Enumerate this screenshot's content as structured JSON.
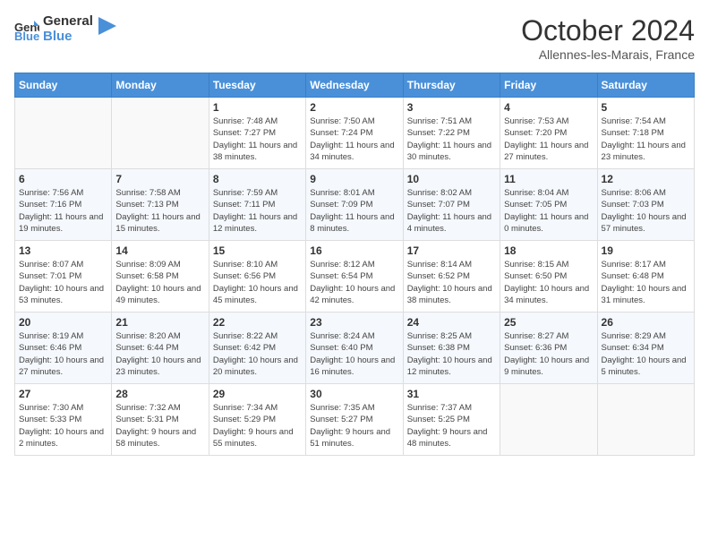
{
  "header": {
    "logo_line1": "General",
    "logo_line2": "Blue",
    "month": "October 2024",
    "location": "Allennes-les-Marais, France"
  },
  "days_of_week": [
    "Sunday",
    "Monday",
    "Tuesday",
    "Wednesday",
    "Thursday",
    "Friday",
    "Saturday"
  ],
  "weeks": [
    [
      {
        "day": "",
        "content": ""
      },
      {
        "day": "",
        "content": ""
      },
      {
        "day": "1",
        "content": "Sunrise: 7:48 AM\nSunset: 7:27 PM\nDaylight: 11 hours and 38 minutes."
      },
      {
        "day": "2",
        "content": "Sunrise: 7:50 AM\nSunset: 7:24 PM\nDaylight: 11 hours and 34 minutes."
      },
      {
        "day": "3",
        "content": "Sunrise: 7:51 AM\nSunset: 7:22 PM\nDaylight: 11 hours and 30 minutes."
      },
      {
        "day": "4",
        "content": "Sunrise: 7:53 AM\nSunset: 7:20 PM\nDaylight: 11 hours and 27 minutes."
      },
      {
        "day": "5",
        "content": "Sunrise: 7:54 AM\nSunset: 7:18 PM\nDaylight: 11 hours and 23 minutes."
      }
    ],
    [
      {
        "day": "6",
        "content": "Sunrise: 7:56 AM\nSunset: 7:16 PM\nDaylight: 11 hours and 19 minutes."
      },
      {
        "day": "7",
        "content": "Sunrise: 7:58 AM\nSunset: 7:13 PM\nDaylight: 11 hours and 15 minutes."
      },
      {
        "day": "8",
        "content": "Sunrise: 7:59 AM\nSunset: 7:11 PM\nDaylight: 11 hours and 12 minutes."
      },
      {
        "day": "9",
        "content": "Sunrise: 8:01 AM\nSunset: 7:09 PM\nDaylight: 11 hours and 8 minutes."
      },
      {
        "day": "10",
        "content": "Sunrise: 8:02 AM\nSunset: 7:07 PM\nDaylight: 11 hours and 4 minutes."
      },
      {
        "day": "11",
        "content": "Sunrise: 8:04 AM\nSunset: 7:05 PM\nDaylight: 11 hours and 0 minutes."
      },
      {
        "day": "12",
        "content": "Sunrise: 8:06 AM\nSunset: 7:03 PM\nDaylight: 10 hours and 57 minutes."
      }
    ],
    [
      {
        "day": "13",
        "content": "Sunrise: 8:07 AM\nSunset: 7:01 PM\nDaylight: 10 hours and 53 minutes."
      },
      {
        "day": "14",
        "content": "Sunrise: 8:09 AM\nSunset: 6:58 PM\nDaylight: 10 hours and 49 minutes."
      },
      {
        "day": "15",
        "content": "Sunrise: 8:10 AM\nSunset: 6:56 PM\nDaylight: 10 hours and 45 minutes."
      },
      {
        "day": "16",
        "content": "Sunrise: 8:12 AM\nSunset: 6:54 PM\nDaylight: 10 hours and 42 minutes."
      },
      {
        "day": "17",
        "content": "Sunrise: 8:14 AM\nSunset: 6:52 PM\nDaylight: 10 hours and 38 minutes."
      },
      {
        "day": "18",
        "content": "Sunrise: 8:15 AM\nSunset: 6:50 PM\nDaylight: 10 hours and 34 minutes."
      },
      {
        "day": "19",
        "content": "Sunrise: 8:17 AM\nSunset: 6:48 PM\nDaylight: 10 hours and 31 minutes."
      }
    ],
    [
      {
        "day": "20",
        "content": "Sunrise: 8:19 AM\nSunset: 6:46 PM\nDaylight: 10 hours and 27 minutes."
      },
      {
        "day": "21",
        "content": "Sunrise: 8:20 AM\nSunset: 6:44 PM\nDaylight: 10 hours and 23 minutes."
      },
      {
        "day": "22",
        "content": "Sunrise: 8:22 AM\nSunset: 6:42 PM\nDaylight: 10 hours and 20 minutes."
      },
      {
        "day": "23",
        "content": "Sunrise: 8:24 AM\nSunset: 6:40 PM\nDaylight: 10 hours and 16 minutes."
      },
      {
        "day": "24",
        "content": "Sunrise: 8:25 AM\nSunset: 6:38 PM\nDaylight: 10 hours and 12 minutes."
      },
      {
        "day": "25",
        "content": "Sunrise: 8:27 AM\nSunset: 6:36 PM\nDaylight: 10 hours and 9 minutes."
      },
      {
        "day": "26",
        "content": "Sunrise: 8:29 AM\nSunset: 6:34 PM\nDaylight: 10 hours and 5 minutes."
      }
    ],
    [
      {
        "day": "27",
        "content": "Sunrise: 7:30 AM\nSunset: 5:33 PM\nDaylight: 10 hours and 2 minutes."
      },
      {
        "day": "28",
        "content": "Sunrise: 7:32 AM\nSunset: 5:31 PM\nDaylight: 9 hours and 58 minutes."
      },
      {
        "day": "29",
        "content": "Sunrise: 7:34 AM\nSunset: 5:29 PM\nDaylight: 9 hours and 55 minutes."
      },
      {
        "day": "30",
        "content": "Sunrise: 7:35 AM\nSunset: 5:27 PM\nDaylight: 9 hours and 51 minutes."
      },
      {
        "day": "31",
        "content": "Sunrise: 7:37 AM\nSunset: 5:25 PM\nDaylight: 9 hours and 48 minutes."
      },
      {
        "day": "",
        "content": ""
      },
      {
        "day": "",
        "content": ""
      }
    ]
  ]
}
